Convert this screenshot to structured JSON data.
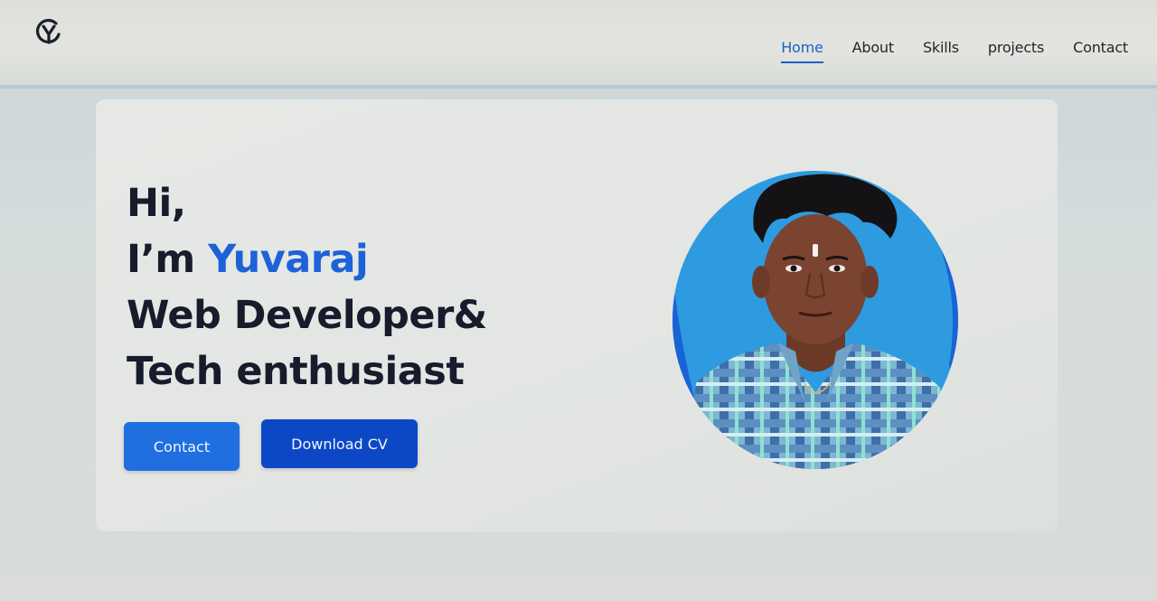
{
  "nav": {
    "logo_letter": "Y",
    "links": [
      {
        "label": "Home",
        "active": true
      },
      {
        "label": "About",
        "active": false
      },
      {
        "label": "Skills",
        "active": false
      },
      {
        "label": "projects",
        "active": false
      },
      {
        "label": "Contact",
        "active": false
      }
    ]
  },
  "hero": {
    "line1": "Hi,",
    "line2_prefix": "I’m ",
    "name": "Yuvaraj",
    "line3": "Web Developer&",
    "line4": "Tech enthusiast",
    "contact_button": "Contact",
    "cv_button": "Download CV"
  },
  "colors": {
    "accent": "#1d62d8",
    "button_primary": "#1f6fe0",
    "button_secondary": "#0c48c6",
    "text_dark": "#161c2b",
    "avatar_bg": "#2e9ae0"
  }
}
